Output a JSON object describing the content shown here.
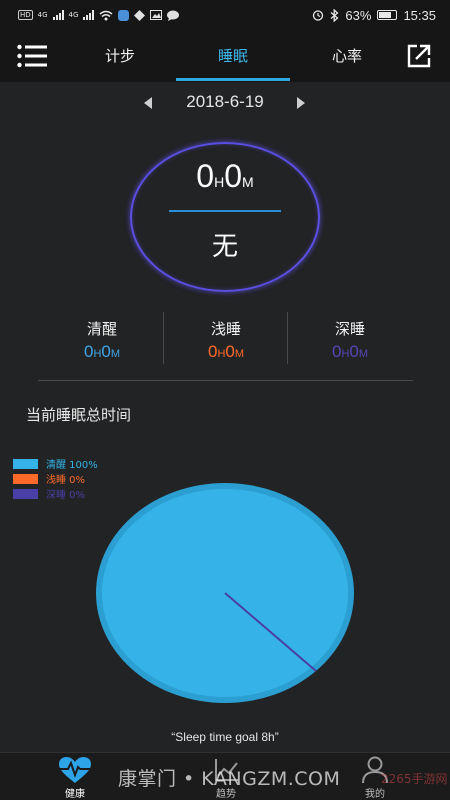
{
  "status_bar": {
    "left_tags": [
      "HD",
      "4G",
      "4G"
    ],
    "battery": "63%",
    "time": "15:35"
  },
  "header": {
    "tabs": [
      {
        "label": "计步"
      },
      {
        "label": "睡眠",
        "active": true
      },
      {
        "label": "心率"
      }
    ],
    "accent_color": "#2fa8e4"
  },
  "date_nav": {
    "date": "2018-6-19"
  },
  "summary": {
    "hours": "0",
    "hours_unit": "H",
    "minutes": "0",
    "minutes_unit": "M",
    "status": "无"
  },
  "stats": [
    {
      "label": "清醒",
      "h": "0",
      "h_unit": "H",
      "m": "0",
      "m_unit": "M",
      "color": "#3fa4e6"
    },
    {
      "label": "浅睡",
      "h": "0",
      "h_unit": "H",
      "m": "0",
      "m_unit": "M",
      "color": "#ff6a2a"
    },
    {
      "label": "深睡",
      "h": "0",
      "h_unit": "H",
      "m": "0",
      "m_unit": "M",
      "color": "#5546b4"
    }
  ],
  "section_title": "当前睡眠总时间",
  "chart_data": {
    "type": "pie",
    "labels": [
      "清醒",
      "浅睡",
      "深睡"
    ],
    "values": [
      100,
      0,
      0
    ],
    "legend_text": [
      "清醒 100%",
      "浅睡 0%",
      "深睡 0%"
    ],
    "colors": [
      "#35b3e8",
      "#ff6a2a",
      "#4a3fa6"
    ],
    "legend_placement": "top-left"
  },
  "goal_text": "“Sleep time goal 8h”",
  "bottom_nav": [
    {
      "label": "健康",
      "icon": "heart-pulse-icon",
      "active": true
    },
    {
      "label": "趋势",
      "icon": "trend-chart-icon"
    },
    {
      "label": "我的",
      "icon": "person-icon"
    }
  ],
  "watermark": {
    "text": "康掌门 • KANGZM.COM",
    "corner": "2265手游网"
  }
}
